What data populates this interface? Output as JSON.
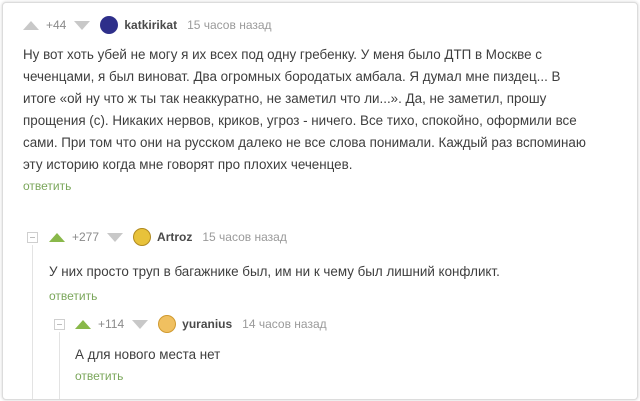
{
  "comments": [
    {
      "rating": "+44",
      "author": "katkirikat",
      "time": "15 часов назад",
      "text": "Ну вот хоть убей не могу я их всех под одну гребенку. У меня было ДТП в Москве с чеченцами, я был виноват. Два огромных бородатых амбала. Я думал мне пиздец... В итоге «ой ну что ж ты так неаккуратно, не заметил что ли...». Да, не заметил, прошу прощения (с). Никаких нервов, криков, угроз - ничего. Все тихо, спокойно, оформили все сами. При том что они на русском далеко не все слова понимали. Каждый раз вспоминаю эту историю когда мне говорят про плохих чеченцев.",
      "reply_label": "ответить",
      "avatar_color": "#2e2f8a"
    },
    {
      "rating": "+277",
      "author": "Artroz",
      "time": "15 часов назад",
      "text": "У них просто труп в багажнике был, им ни к чему был лишний конфликт.",
      "reply_label": "ответить",
      "avatar_color": "#e8c23a"
    },
    {
      "rating": "+114",
      "author": "yuranius",
      "time": "14 часов назад",
      "text": "А для нового места нет",
      "reply_label": "ответить",
      "avatar_color": "#f0c060"
    }
  ]
}
